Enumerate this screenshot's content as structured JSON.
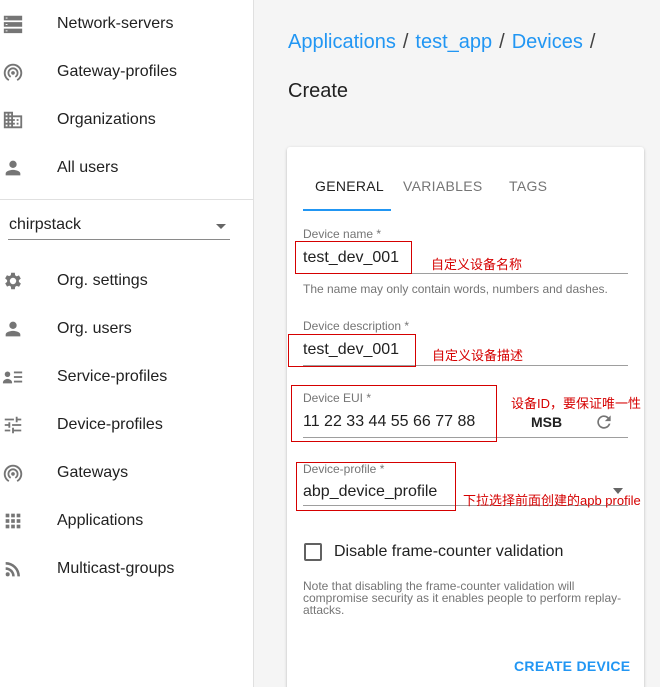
{
  "sidebar": {
    "top_items": [
      {
        "label": "Network-servers",
        "icon": "server-icon"
      },
      {
        "label": "Gateway-profiles",
        "icon": "gateway-profile-icon"
      },
      {
        "label": "Organizations",
        "icon": "building-icon"
      },
      {
        "label": "All users",
        "icon": "person-icon"
      }
    ],
    "org_select": {
      "value": "chirpstack",
      "icon": "chevron-down-icon"
    },
    "org_items": [
      {
        "label": "Org. settings",
        "icon": "gear-icon"
      },
      {
        "label": "Org. users",
        "icon": "person-icon"
      },
      {
        "label": "Service-profiles",
        "icon": "list-icon"
      },
      {
        "label": "Device-profiles",
        "icon": "tune-icon"
      },
      {
        "label": "Gateways",
        "icon": "wifi-tethering-icon"
      },
      {
        "label": "Applications",
        "icon": "apps-grid-icon"
      },
      {
        "label": "Multicast-groups",
        "icon": "rss-icon"
      }
    ]
  },
  "breadcrumb": {
    "items": [
      "Applications",
      "test_app",
      "Devices"
    ],
    "separator": "/"
  },
  "page_title": "Create",
  "tabs": [
    {
      "label": "GENERAL",
      "active": true
    },
    {
      "label": "VARIABLES",
      "active": false
    },
    {
      "label": "TAGS",
      "active": false
    }
  ],
  "form": {
    "device_name": {
      "label": "Device name *",
      "value": "test_dev_001",
      "helper": "The name may only contain words, numbers and dashes."
    },
    "device_description": {
      "label": "Device description *",
      "value": "test_dev_001"
    },
    "device_eui": {
      "label": "Device EUI *",
      "value": "11 22 33 44 55 66 77 88",
      "byte_order": "MSB",
      "refresh_icon": "refresh-icon"
    },
    "device_profile": {
      "label": "Device-profile *",
      "value": "abp_device_profile"
    },
    "disable_fcnt": {
      "label": "Disable frame-counter validation",
      "checked": false,
      "note": "Note that disabling the frame-counter validation will compromise security as it enables people to perform replay-attacks."
    },
    "submit_label": "CREATE DEVICE"
  },
  "annotations": {
    "name": "自定义设备名称",
    "description": "自定义设备描述",
    "eui": "设备ID，要保证唯一性",
    "profile": "下拉选择前面创建的apb profile"
  },
  "colors": {
    "accent": "#2196f3",
    "annotation": "#d50000",
    "icon": "#757575"
  }
}
